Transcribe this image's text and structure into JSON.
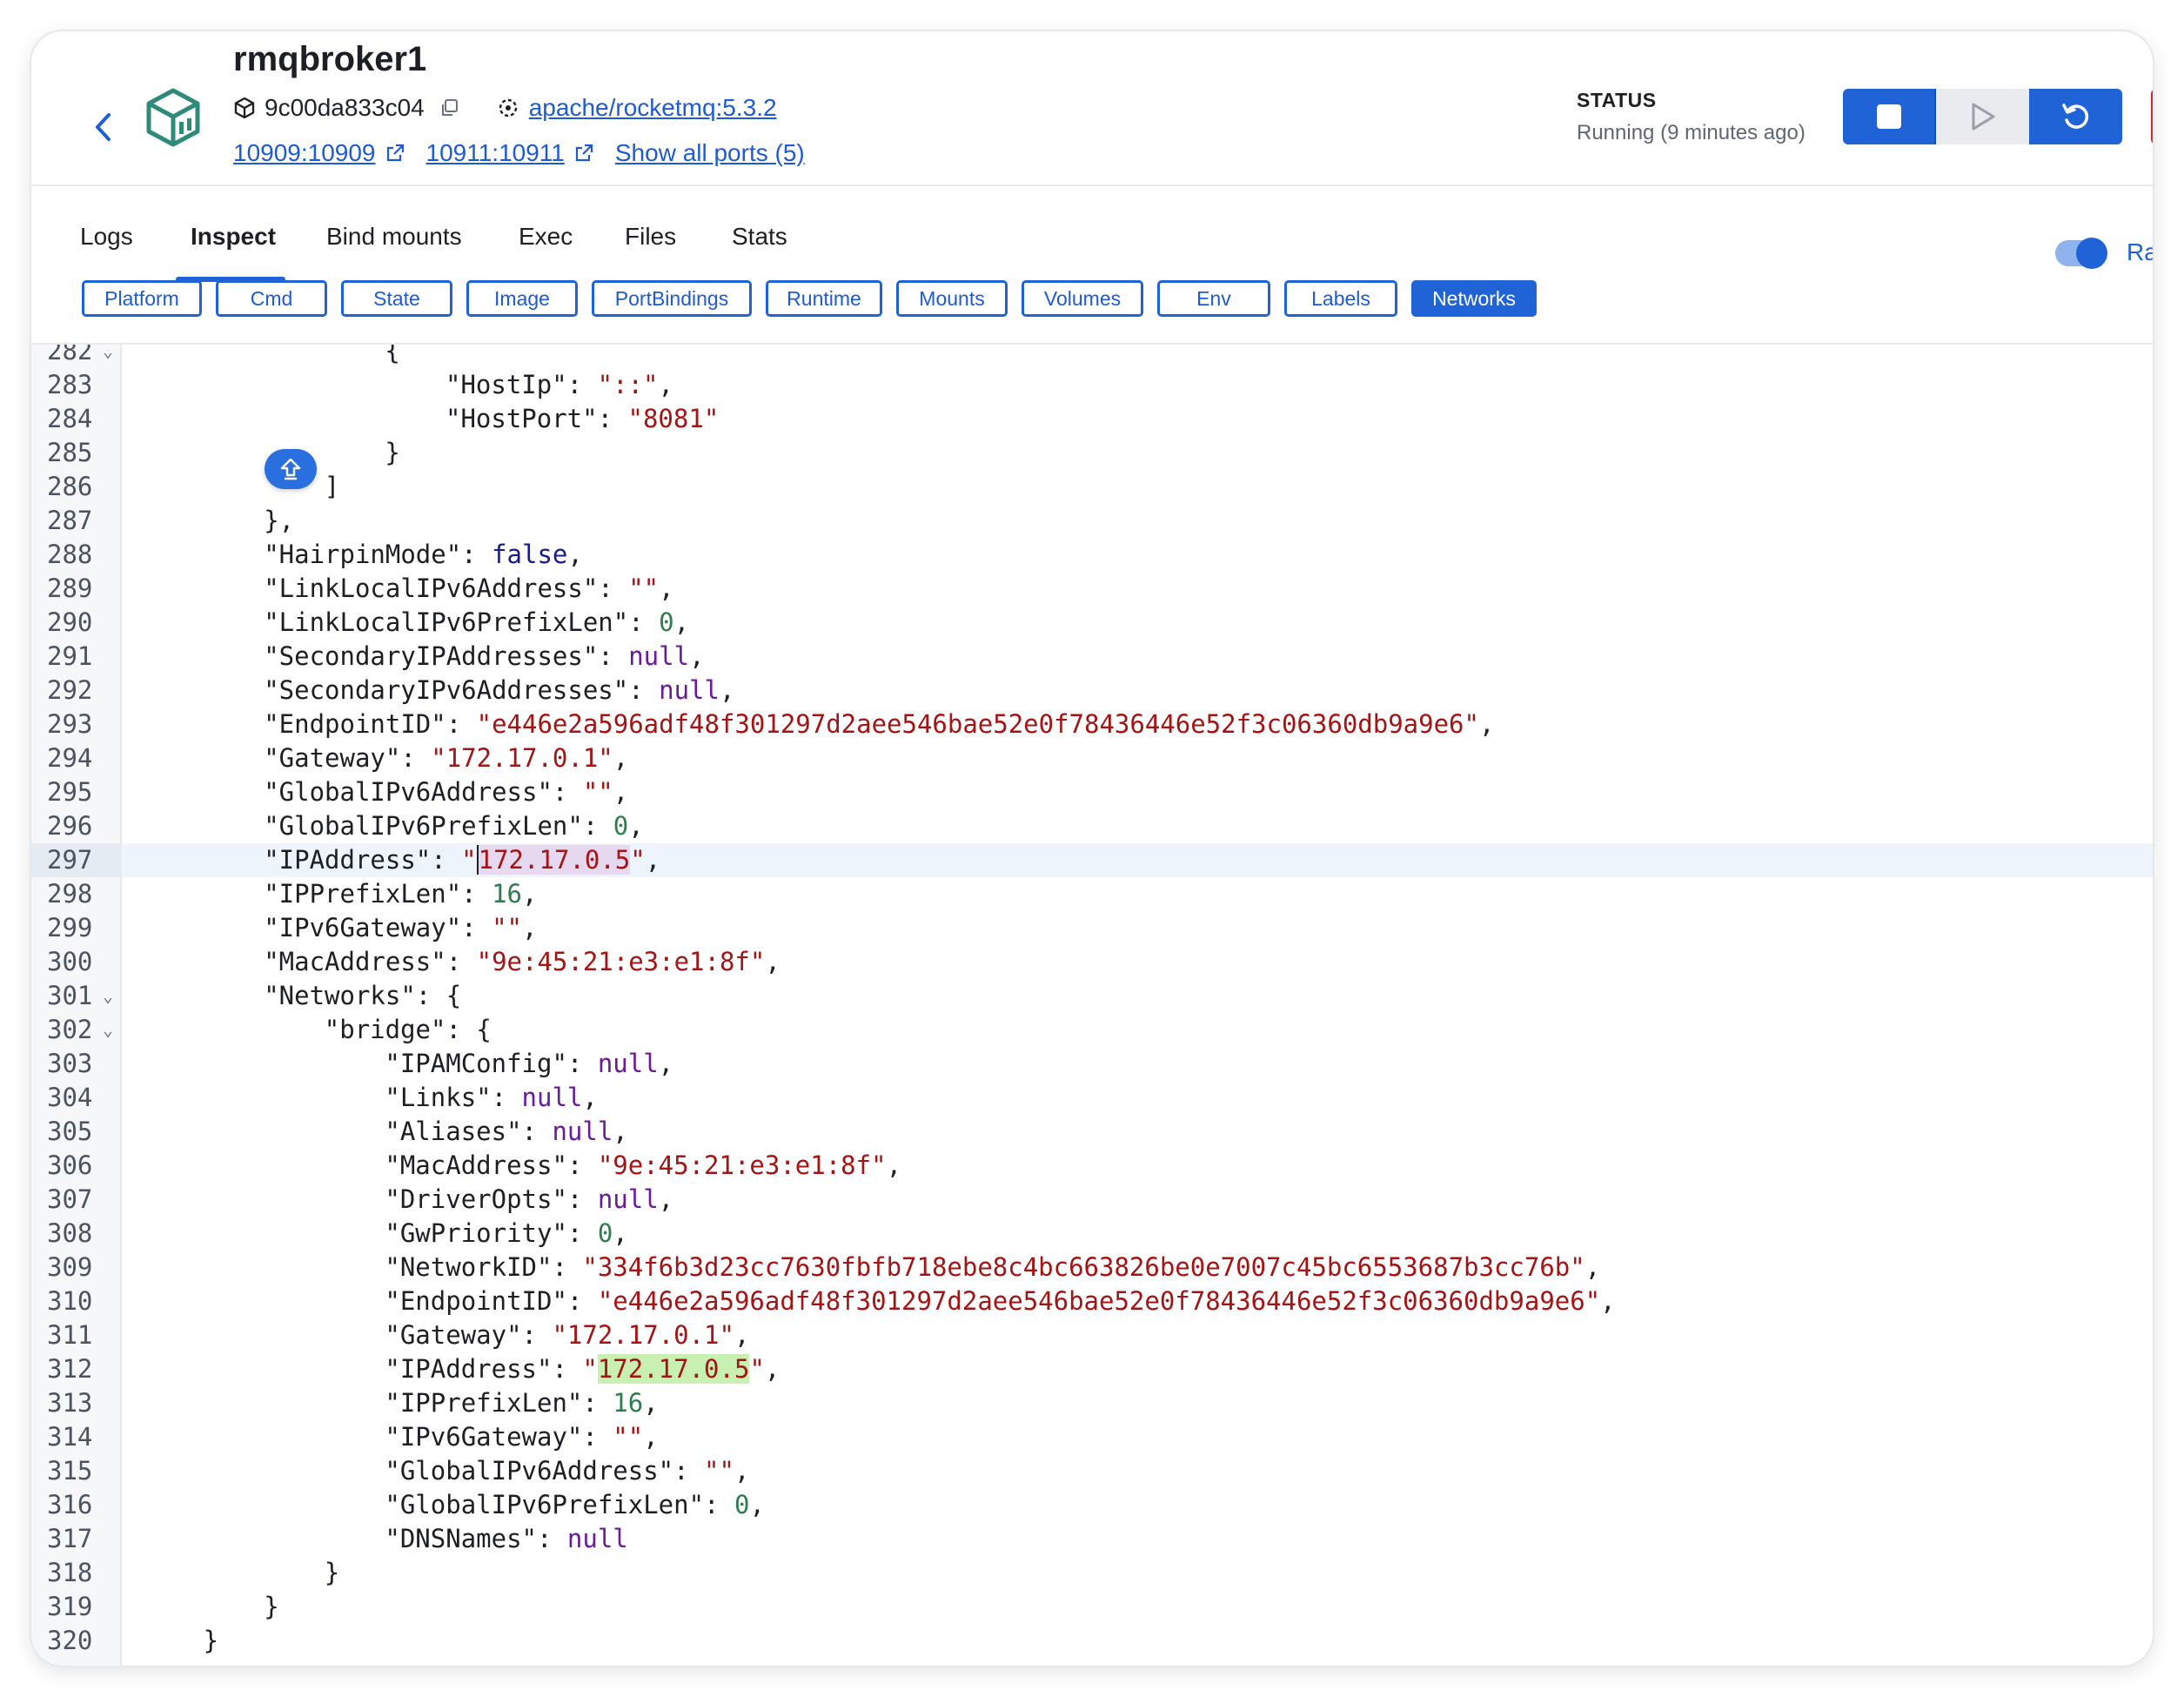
{
  "header": {
    "container_name": "rmqbroker1",
    "container_id": "9c00da833c04",
    "image": "apache/rocketmq:5.3.2",
    "ports": [
      "10909:10909",
      "10911:10911"
    ],
    "show_ports": "Show all ports (5)",
    "status_label": "STATUS",
    "status_text": "Running (9 minutes ago)"
  },
  "tabs": [
    "Logs",
    "Inspect",
    "Bind mounts",
    "Exec",
    "Files",
    "Stats"
  ],
  "active_tab": "Inspect",
  "toggle_label": "Ra",
  "chips": [
    "Platform",
    "Cmd",
    "State",
    "Image",
    "PortBindings",
    "Runtime",
    "Mounts",
    "Volumes",
    "Env",
    "Labels",
    "Networks"
  ],
  "active_chip": "Networks",
  "colors": {
    "accent": "#1f63d6",
    "string": "#a31515",
    "keyword": "#1a1a8f",
    "null": "#6a1b9a",
    "number": "#2e7d4f",
    "danger": "#d72c2c"
  },
  "code_lines": [
    {
      "n": "282",
      "fold": true,
      "indent": 16,
      "parts": [
        [
          "p",
          "{"
        ]
      ]
    },
    {
      "n": "283",
      "indent": 20,
      "parts": [
        [
          "p",
          "\"HostIp\": "
        ],
        [
          "s",
          "\"::\""
        ],
        [
          "p",
          ","
        ]
      ]
    },
    {
      "n": "284",
      "indent": 20,
      "parts": [
        [
          "p",
          "\"HostPort\": "
        ],
        [
          "s",
          "\"8081\""
        ]
      ]
    },
    {
      "n": "285",
      "indent": 16,
      "parts": [
        [
          "p",
          "}"
        ]
      ]
    },
    {
      "n": "286",
      "indent": 12,
      "parts": [
        [
          "p",
          "]"
        ]
      ]
    },
    {
      "n": "287",
      "indent": 8,
      "parts": [
        [
          "p",
          "},"
        ]
      ]
    },
    {
      "n": "288",
      "indent": 8,
      "parts": [
        [
          "p",
          "\"HairpinMode\": "
        ],
        [
          "k",
          "false"
        ],
        [
          "p",
          ","
        ]
      ]
    },
    {
      "n": "289",
      "indent": 8,
      "parts": [
        [
          "p",
          "\"LinkLocalIPv6Address\": "
        ],
        [
          "s",
          "\"\""
        ],
        [
          "p",
          ","
        ]
      ]
    },
    {
      "n": "290",
      "indent": 8,
      "parts": [
        [
          "p",
          "\"LinkLocalIPv6PrefixLen\": "
        ],
        [
          "d",
          "0"
        ],
        [
          "p",
          ","
        ]
      ]
    },
    {
      "n": "291",
      "indent": 8,
      "parts": [
        [
          "p",
          "\"SecondaryIPAddresses\": "
        ],
        [
          "u",
          "null"
        ],
        [
          "p",
          ","
        ]
      ]
    },
    {
      "n": "292",
      "indent": 8,
      "parts": [
        [
          "p",
          "\"SecondaryIPv6Addresses\": "
        ],
        [
          "u",
          "null"
        ],
        [
          "p",
          ","
        ]
      ]
    },
    {
      "n": "293",
      "indent": 8,
      "parts": [
        [
          "p",
          "\"EndpointID\": "
        ],
        [
          "s",
          "\"e446e2a596adf48f301297d2aee546bae52e0f78436446e52f3c06360db9a9e6\""
        ],
        [
          "p",
          ","
        ]
      ]
    },
    {
      "n": "294",
      "indent": 8,
      "parts": [
        [
          "p",
          "\"Gateway\": "
        ],
        [
          "s",
          "\"172.17.0.1\""
        ],
        [
          "p",
          ","
        ]
      ]
    },
    {
      "n": "295",
      "indent": 8,
      "parts": [
        [
          "p",
          "\"GlobalIPv6Address\": "
        ],
        [
          "s",
          "\"\""
        ],
        [
          "p",
          ","
        ]
      ]
    },
    {
      "n": "296",
      "indent": 8,
      "parts": [
        [
          "p",
          "\"GlobalIPv6PrefixLen\": "
        ],
        [
          "d",
          "0"
        ],
        [
          "p",
          ","
        ]
      ]
    },
    {
      "n": "297",
      "indent": 8,
      "current": true,
      "parts": [
        [
          "p",
          "\"IPAddress\": "
        ],
        [
          "s",
          "\""
        ],
        [
          "sel",
          "172.17.0.5"
        ],
        [
          "s",
          "\""
        ],
        [
          "p",
          ","
        ]
      ]
    },
    {
      "n": "298",
      "indent": 8,
      "parts": [
        [
          "p",
          "\"IPPrefixLen\": "
        ],
        [
          "d",
          "16"
        ],
        [
          "p",
          ","
        ]
      ]
    },
    {
      "n": "299",
      "indent": 8,
      "parts": [
        [
          "p",
          "\"IPv6Gateway\": "
        ],
        [
          "s",
          "\"\""
        ],
        [
          "p",
          ","
        ]
      ]
    },
    {
      "n": "300",
      "indent": 8,
      "parts": [
        [
          "p",
          "\"MacAddress\": "
        ],
        [
          "s",
          "\"9e:45:21:e3:e1:8f\""
        ],
        [
          "p",
          ","
        ]
      ]
    },
    {
      "n": "301",
      "fold": true,
      "indent": 8,
      "parts": [
        [
          "p",
          "\"Networks\": {"
        ]
      ]
    },
    {
      "n": "302",
      "fold": true,
      "indent": 12,
      "parts": [
        [
          "p",
          "\"bridge\": {"
        ]
      ]
    },
    {
      "n": "303",
      "indent": 16,
      "parts": [
        [
          "p",
          "\"IPAMConfig\": "
        ],
        [
          "u",
          "null"
        ],
        [
          "p",
          ","
        ]
      ]
    },
    {
      "n": "304",
      "indent": 16,
      "parts": [
        [
          "p",
          "\"Links\": "
        ],
        [
          "u",
          "null"
        ],
        [
          "p",
          ","
        ]
      ]
    },
    {
      "n": "305",
      "indent": 16,
      "parts": [
        [
          "p",
          "\"Aliases\": "
        ],
        [
          "u",
          "null"
        ],
        [
          "p",
          ","
        ]
      ]
    },
    {
      "n": "306",
      "indent": 16,
      "parts": [
        [
          "p",
          "\"MacAddress\": "
        ],
        [
          "s",
          "\"9e:45:21:e3:e1:8f\""
        ],
        [
          "p",
          ","
        ]
      ]
    },
    {
      "n": "307",
      "indent": 16,
      "parts": [
        [
          "p",
          "\"DriverOpts\": "
        ],
        [
          "u",
          "null"
        ],
        [
          "p",
          ","
        ]
      ]
    },
    {
      "n": "308",
      "indent": 16,
      "parts": [
        [
          "p",
          "\"GwPriority\": "
        ],
        [
          "d",
          "0"
        ],
        [
          "p",
          ","
        ]
      ]
    },
    {
      "n": "309",
      "indent": 16,
      "parts": [
        [
          "p",
          "\"NetworkID\": "
        ],
        [
          "s",
          "\"334f6b3d23cc7630fbfb718ebe8c4bc663826be0e7007c45bc6553687b3cc76b\""
        ],
        [
          "p",
          ","
        ]
      ]
    },
    {
      "n": "310",
      "indent": 16,
      "parts": [
        [
          "p",
          "\"EndpointID\": "
        ],
        [
          "s",
          "\"e446e2a596adf48f301297d2aee546bae52e0f78436446e52f3c06360db9a9e6\""
        ],
        [
          "p",
          ","
        ]
      ]
    },
    {
      "n": "311",
      "indent": 16,
      "parts": [
        [
          "p",
          "\"Gateway\": "
        ],
        [
          "s",
          "\"172.17.0.1\""
        ],
        [
          "p",
          ","
        ]
      ]
    },
    {
      "n": "312",
      "indent": 16,
      "parts": [
        [
          "p",
          "\"IPAddress\": "
        ],
        [
          "s",
          "\""
        ],
        [
          "m",
          "172.17.0.5"
        ],
        [
          "s",
          "\""
        ],
        [
          "p",
          ","
        ]
      ]
    },
    {
      "n": "313",
      "indent": 16,
      "parts": [
        [
          "p",
          "\"IPPrefixLen\": "
        ],
        [
          "d",
          "16"
        ],
        [
          "p",
          ","
        ]
      ]
    },
    {
      "n": "314",
      "indent": 16,
      "parts": [
        [
          "p",
          "\"IPv6Gateway\": "
        ],
        [
          "s",
          "\"\""
        ],
        [
          "p",
          ","
        ]
      ]
    },
    {
      "n": "315",
      "indent": 16,
      "parts": [
        [
          "p",
          "\"GlobalIPv6Address\": "
        ],
        [
          "s",
          "\"\""
        ],
        [
          "p",
          ","
        ]
      ]
    },
    {
      "n": "316",
      "indent": 16,
      "parts": [
        [
          "p",
          "\"GlobalIPv6PrefixLen\": "
        ],
        [
          "d",
          "0"
        ],
        [
          "p",
          ","
        ]
      ]
    },
    {
      "n": "317",
      "indent": 16,
      "parts": [
        [
          "p",
          "\"DNSNames\": "
        ],
        [
          "u",
          "null"
        ]
      ]
    },
    {
      "n": "318",
      "indent": 12,
      "parts": [
        [
          "p",
          "}"
        ]
      ]
    },
    {
      "n": "319",
      "indent": 8,
      "parts": [
        [
          "p",
          "}"
        ]
      ]
    },
    {
      "n": "320",
      "indent": 4,
      "parts": [
        [
          "p",
          "}"
        ]
      ]
    }
  ]
}
